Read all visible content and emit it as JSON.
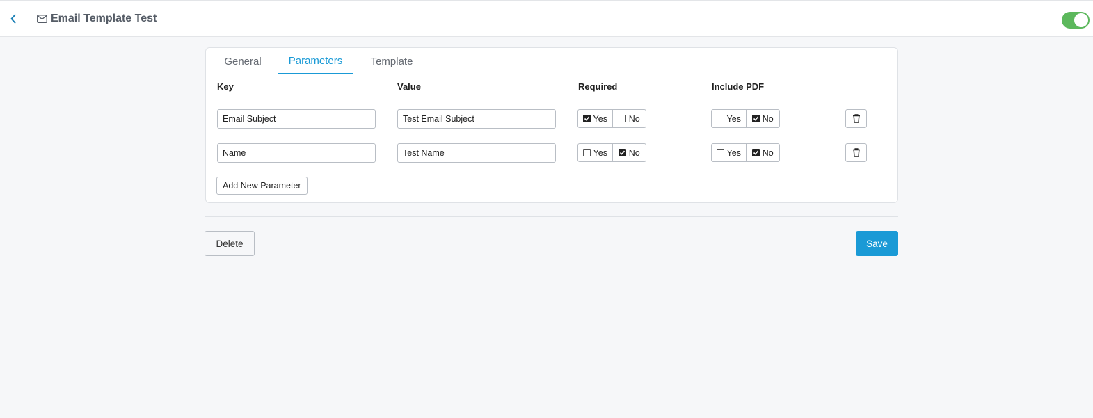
{
  "header": {
    "title": "Email Template Test",
    "toggle_on": true
  },
  "tabs": [
    {
      "label": "General",
      "active": false
    },
    {
      "label": "Parameters",
      "active": true
    },
    {
      "label": "Template",
      "active": false
    }
  ],
  "table": {
    "columns": [
      "Key",
      "Value",
      "Required",
      "Include PDF"
    ],
    "rows": [
      {
        "key": "Email Subject",
        "value": "Test Email Subject",
        "required": "Yes",
        "include_pdf": "No"
      },
      {
        "key": "Name",
        "value": "Test Name",
        "required": "No",
        "include_pdf": "No"
      }
    ],
    "yes_label": "Yes",
    "no_label": "No"
  },
  "add_button": "Add New Parameter",
  "footer": {
    "delete_label": "Delete",
    "save_label": "Save"
  },
  "colors": {
    "accent": "#1a9ad6",
    "toggle": "#5cb85c"
  },
  "icons": {
    "back": "chevron-left-icon",
    "title": "envelope-icon",
    "row_delete": "trash-icon"
  }
}
